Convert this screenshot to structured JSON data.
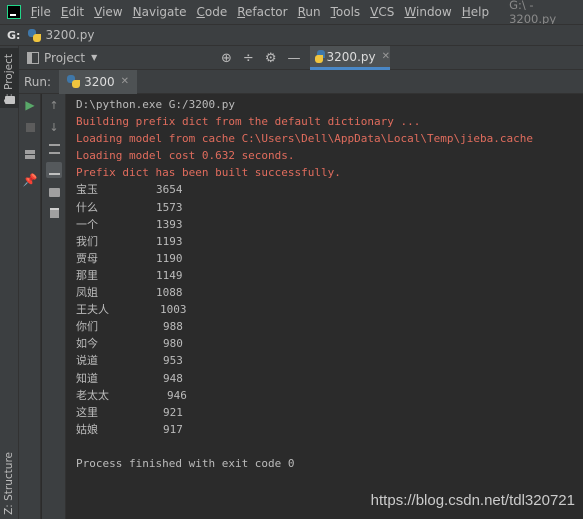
{
  "menubar": {
    "items": [
      {
        "label": "File",
        "u": "F",
        "rest": "ile"
      },
      {
        "label": "Edit",
        "u": "E",
        "rest": "dit"
      },
      {
        "label": "View",
        "u": "V",
        "rest": "iew"
      },
      {
        "label": "Navigate",
        "u": "N",
        "rest": "avigate"
      },
      {
        "label": "Code",
        "u": "C",
        "rest": "ode"
      },
      {
        "label": "Refactor",
        "u": "R",
        "rest": "efactor"
      },
      {
        "label": "Run",
        "u": "R",
        "rest": "un"
      },
      {
        "label": "Tools",
        "u": "T",
        "rest": "ools"
      },
      {
        "label": "VCS",
        "u": "V",
        "rest": "CS"
      },
      {
        "label": "Window",
        "u": "W",
        "rest": "indow"
      },
      {
        "label": "Help",
        "u": "H",
        "rest": "elp"
      }
    ],
    "window_title": "G:\\ - 3200.py"
  },
  "navbar": {
    "drive": "G:",
    "file": "3200.py"
  },
  "left_strip": {
    "top_label": "1: Project",
    "bottom_label": "Z: Structure"
  },
  "project_toolbar": {
    "label": "Project",
    "editor_tab": "3200.py"
  },
  "run_header": {
    "label": "Run:",
    "tab": "3200"
  },
  "console": {
    "command": "D:\\python.exe G:/3200.py",
    "messages": [
      "Building prefix dict from the default dictionary ...",
      "Loading model from cache C:\\Users\\Dell\\AppData\\Local\\Temp\\jieba.cache",
      "Loading model cost 0.632 seconds.",
      "Prefix dict has been built successfully."
    ],
    "rows": [
      {
        "word": "宝玉",
        "count": "3654"
      },
      {
        "word": "什么",
        "count": "1573"
      },
      {
        "word": "一个",
        "count": "1393"
      },
      {
        "word": "我们",
        "count": "1193"
      },
      {
        "word": "贾母",
        "count": "1190"
      },
      {
        "word": "那里",
        "count": "1149"
      },
      {
        "word": "凤姐",
        "count": "1088"
      },
      {
        "word": "王夫人",
        "count": "1003"
      },
      {
        "word": "你们",
        "count": "988"
      },
      {
        "word": "如今",
        "count": "980"
      },
      {
        "word": "说道",
        "count": "953"
      },
      {
        "word": "知道",
        "count": "948"
      },
      {
        "word": "老太太",
        "count": "946"
      },
      {
        "word": "这里",
        "count": "921"
      },
      {
        "word": "姑娘",
        "count": "917"
      }
    ],
    "finish": "Process finished with exit code 0"
  },
  "watermark": "https://blog.csdn.net/tdl320721"
}
